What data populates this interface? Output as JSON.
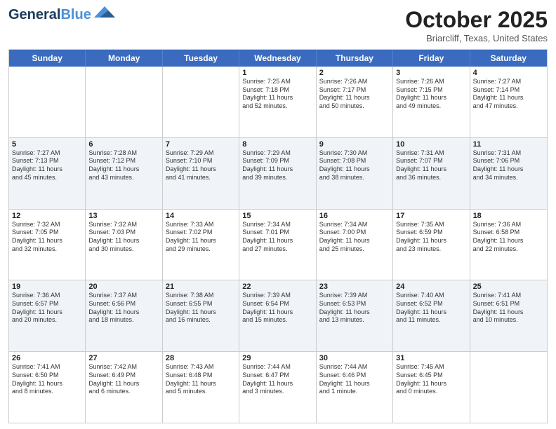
{
  "header": {
    "logo_line1": "General",
    "logo_line2": "Blue",
    "month": "October 2025",
    "location": "Briarcliff, Texas, United States"
  },
  "days_of_week": [
    "Sunday",
    "Monday",
    "Tuesday",
    "Wednesday",
    "Thursday",
    "Friday",
    "Saturday"
  ],
  "rows": [
    {
      "alt": false,
      "cells": [
        {
          "day": "",
          "text": ""
        },
        {
          "day": "",
          "text": ""
        },
        {
          "day": "",
          "text": ""
        },
        {
          "day": "1",
          "text": "Sunrise: 7:25 AM\nSunset: 7:18 PM\nDaylight: 11 hours\nand 52 minutes."
        },
        {
          "day": "2",
          "text": "Sunrise: 7:26 AM\nSunset: 7:17 PM\nDaylight: 11 hours\nand 50 minutes."
        },
        {
          "day": "3",
          "text": "Sunrise: 7:26 AM\nSunset: 7:15 PM\nDaylight: 11 hours\nand 49 minutes."
        },
        {
          "day": "4",
          "text": "Sunrise: 7:27 AM\nSunset: 7:14 PM\nDaylight: 11 hours\nand 47 minutes."
        }
      ]
    },
    {
      "alt": true,
      "cells": [
        {
          "day": "5",
          "text": "Sunrise: 7:27 AM\nSunset: 7:13 PM\nDaylight: 11 hours\nand 45 minutes."
        },
        {
          "day": "6",
          "text": "Sunrise: 7:28 AM\nSunset: 7:12 PM\nDaylight: 11 hours\nand 43 minutes."
        },
        {
          "day": "7",
          "text": "Sunrise: 7:29 AM\nSunset: 7:10 PM\nDaylight: 11 hours\nand 41 minutes."
        },
        {
          "day": "8",
          "text": "Sunrise: 7:29 AM\nSunset: 7:09 PM\nDaylight: 11 hours\nand 39 minutes."
        },
        {
          "day": "9",
          "text": "Sunrise: 7:30 AM\nSunset: 7:08 PM\nDaylight: 11 hours\nand 38 minutes."
        },
        {
          "day": "10",
          "text": "Sunrise: 7:31 AM\nSunset: 7:07 PM\nDaylight: 11 hours\nand 36 minutes."
        },
        {
          "day": "11",
          "text": "Sunrise: 7:31 AM\nSunset: 7:06 PM\nDaylight: 11 hours\nand 34 minutes."
        }
      ]
    },
    {
      "alt": false,
      "cells": [
        {
          "day": "12",
          "text": "Sunrise: 7:32 AM\nSunset: 7:05 PM\nDaylight: 11 hours\nand 32 minutes."
        },
        {
          "day": "13",
          "text": "Sunrise: 7:32 AM\nSunset: 7:03 PM\nDaylight: 11 hours\nand 30 minutes."
        },
        {
          "day": "14",
          "text": "Sunrise: 7:33 AM\nSunset: 7:02 PM\nDaylight: 11 hours\nand 29 minutes."
        },
        {
          "day": "15",
          "text": "Sunrise: 7:34 AM\nSunset: 7:01 PM\nDaylight: 11 hours\nand 27 minutes."
        },
        {
          "day": "16",
          "text": "Sunrise: 7:34 AM\nSunset: 7:00 PM\nDaylight: 11 hours\nand 25 minutes."
        },
        {
          "day": "17",
          "text": "Sunrise: 7:35 AM\nSunset: 6:59 PM\nDaylight: 11 hours\nand 23 minutes."
        },
        {
          "day": "18",
          "text": "Sunrise: 7:36 AM\nSunset: 6:58 PM\nDaylight: 11 hours\nand 22 minutes."
        }
      ]
    },
    {
      "alt": true,
      "cells": [
        {
          "day": "19",
          "text": "Sunrise: 7:36 AM\nSunset: 6:57 PM\nDaylight: 11 hours\nand 20 minutes."
        },
        {
          "day": "20",
          "text": "Sunrise: 7:37 AM\nSunset: 6:56 PM\nDaylight: 11 hours\nand 18 minutes."
        },
        {
          "day": "21",
          "text": "Sunrise: 7:38 AM\nSunset: 6:55 PM\nDaylight: 11 hours\nand 16 minutes."
        },
        {
          "day": "22",
          "text": "Sunrise: 7:39 AM\nSunset: 6:54 PM\nDaylight: 11 hours\nand 15 minutes."
        },
        {
          "day": "23",
          "text": "Sunrise: 7:39 AM\nSunset: 6:53 PM\nDaylight: 11 hours\nand 13 minutes."
        },
        {
          "day": "24",
          "text": "Sunrise: 7:40 AM\nSunset: 6:52 PM\nDaylight: 11 hours\nand 11 minutes."
        },
        {
          "day": "25",
          "text": "Sunrise: 7:41 AM\nSunset: 6:51 PM\nDaylight: 11 hours\nand 10 minutes."
        }
      ]
    },
    {
      "alt": false,
      "cells": [
        {
          "day": "26",
          "text": "Sunrise: 7:41 AM\nSunset: 6:50 PM\nDaylight: 11 hours\nand 8 minutes."
        },
        {
          "day": "27",
          "text": "Sunrise: 7:42 AM\nSunset: 6:49 PM\nDaylight: 11 hours\nand 6 minutes."
        },
        {
          "day": "28",
          "text": "Sunrise: 7:43 AM\nSunset: 6:48 PM\nDaylight: 11 hours\nand 5 minutes."
        },
        {
          "day": "29",
          "text": "Sunrise: 7:44 AM\nSunset: 6:47 PM\nDaylight: 11 hours\nand 3 minutes."
        },
        {
          "day": "30",
          "text": "Sunrise: 7:44 AM\nSunset: 6:46 PM\nDaylight: 11 hours\nand 1 minute."
        },
        {
          "day": "31",
          "text": "Sunrise: 7:45 AM\nSunset: 6:45 PM\nDaylight: 11 hours\nand 0 minutes."
        },
        {
          "day": "",
          "text": ""
        }
      ]
    }
  ]
}
